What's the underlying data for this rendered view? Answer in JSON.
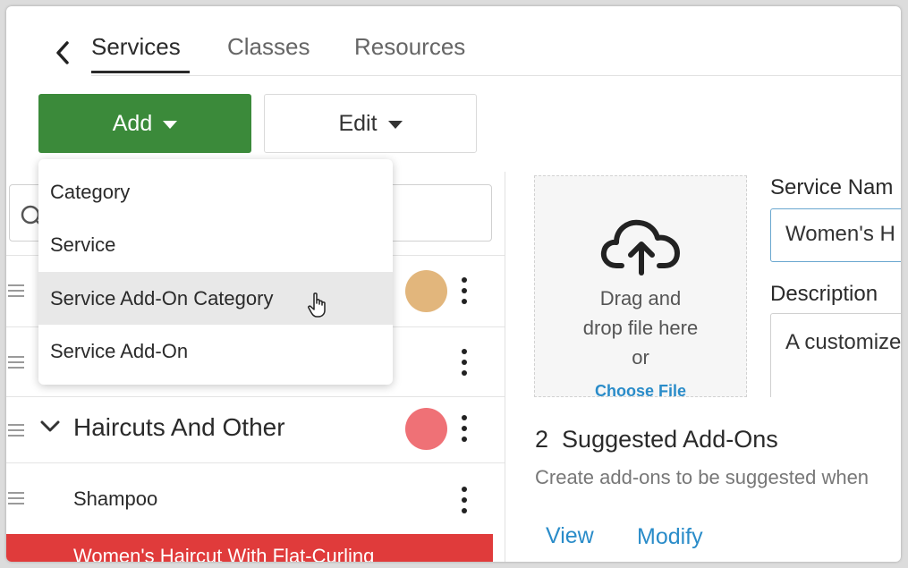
{
  "tabs": [
    {
      "label": "Services",
      "active": true
    },
    {
      "label": "Classes",
      "active": false
    },
    {
      "label": "Resources",
      "active": false
    }
  ],
  "toolbar": {
    "add_label": "Add",
    "edit_label": "Edit",
    "add_color": "#3b8a3a"
  },
  "dropdown": {
    "items": [
      {
        "label": "Category"
      },
      {
        "label": "Service"
      },
      {
        "label": "Service Add-On Category",
        "hovered": true
      },
      {
        "label": "Service Add-On"
      }
    ]
  },
  "list": {
    "rows": [
      {
        "type": "hidden-category",
        "dot_color": "#e2b67c"
      },
      {
        "type": "hidden-service"
      },
      {
        "type": "category",
        "label": "Haircuts And Other",
        "dot_color": "#ef7176"
      },
      {
        "type": "service",
        "label": "Shampoo"
      },
      {
        "type": "service-selected",
        "label": "Women's Haircut With Flat-Curling",
        "color": "#e03b3b"
      }
    ]
  },
  "upload": {
    "line1": "Drag and",
    "line2": "drop file here",
    "line3": "or",
    "choose_file": "Choose File"
  },
  "form": {
    "service_name_label": "Service Nam",
    "service_name_value": "Women's H",
    "description_label": "Description",
    "description_value": "A customize"
  },
  "addons": {
    "count": "2",
    "title": "Suggested Add-Ons",
    "description": "Create add-ons to be suggested when",
    "view_label": "View",
    "modify_label": "Modify"
  }
}
